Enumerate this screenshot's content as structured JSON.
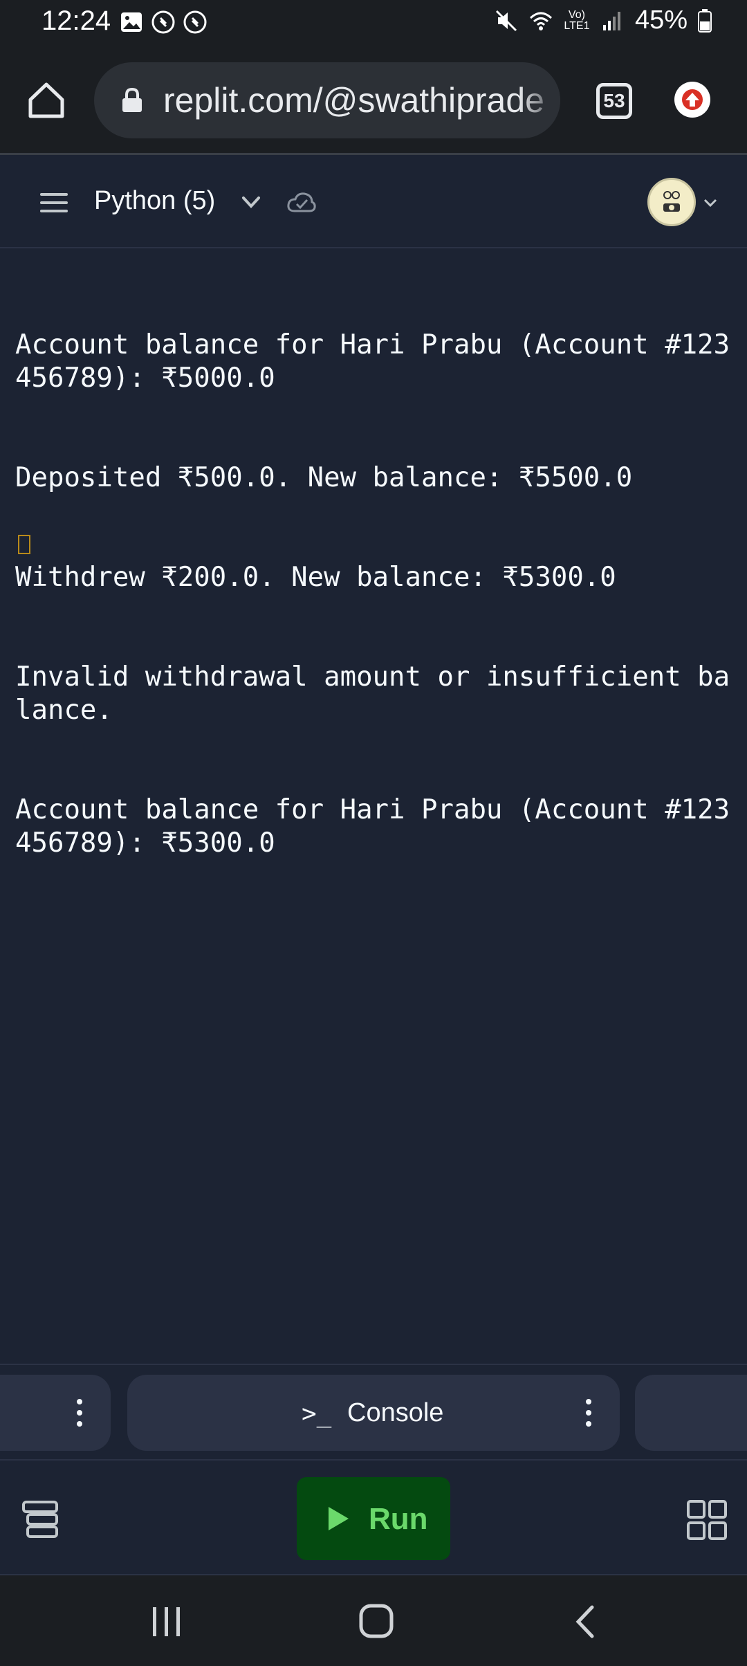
{
  "status_bar": {
    "time": "12:24",
    "battery": "45%",
    "network_label": "Vo) LTE1"
  },
  "browser": {
    "url": "replit.com/@swathiprade",
    "tab_count": "53"
  },
  "header": {
    "project_name": "Python (5)"
  },
  "console": {
    "lines": [
      "Account balance for Hari Prabu (Account #123456789): ₹5000.0",
      "Deposited ₹500.0. New balance: ₹5500.0",
      "Withdrew ₹200.0. New balance: ₹5300.0",
      "Invalid withdrawal amount or insufficient balance.",
      "Account balance for Hari Prabu (Account #123456789): ₹5300.0"
    ]
  },
  "tabs": {
    "console_icon": ">_",
    "console_label": "Console"
  },
  "toolbar": {
    "run_label": "Run"
  },
  "colors": {
    "background": "#1c2333",
    "surface": "#2b3245",
    "run_bg": "#044a10",
    "run_fg": "#6bd96b"
  }
}
